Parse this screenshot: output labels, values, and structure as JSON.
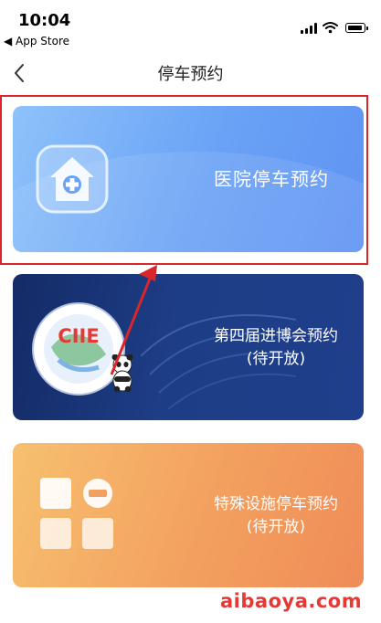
{
  "status_bar": {
    "time": "10:04",
    "back_app": "◀ App Store"
  },
  "nav": {
    "back_icon": "chevron-left-icon",
    "title": "停车预约"
  },
  "cards": {
    "hospital": {
      "label": "医院停车预约",
      "icon": "hospital-cross-icon"
    },
    "ciie": {
      "label_line1": "第四届进博会预约",
      "label_line2": "(待开放)",
      "logo_text": "CIIE",
      "icon": "ciie-logo-icon"
    },
    "special": {
      "label_line1": "特殊设施停车预约",
      "label_line2": "(待开放)",
      "icon": "facility-grid-icon"
    }
  },
  "watermark": {
    "text": "aibaoya.com"
  },
  "colors": {
    "highlight": "#d9262a",
    "hospital_card": "#6aa2f6",
    "ciie_card": "#1d3d86",
    "special_card": "#f3a05f"
  }
}
